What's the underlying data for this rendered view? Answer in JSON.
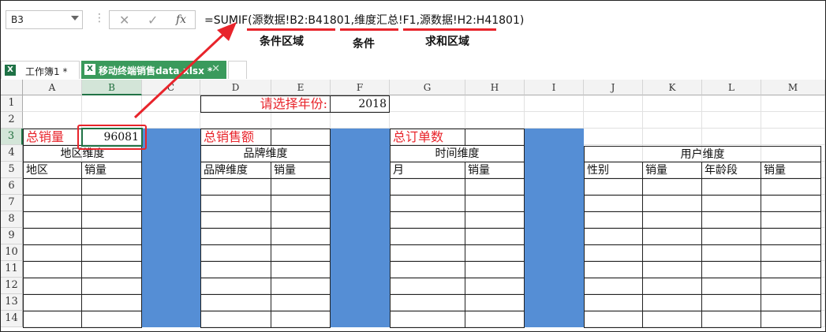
{
  "formula_bar": {
    "name_box": "B3",
    "cancel_icon": "✕",
    "enter_icon": "✓",
    "fx_label": "fx",
    "formula": "=SUMIF(源数据!B2:B41801,维度汇总!F1,源数据!H2:H41801)",
    "annotations": [
      "条件区域",
      "条件",
      "求和区域"
    ]
  },
  "tabs": [
    {
      "label": "工作簿1 *"
    },
    {
      "label": "移动终端销售data.xlsx *"
    }
  ],
  "columns": [
    "A",
    "B",
    "C",
    "D",
    "E",
    "F",
    "G",
    "H",
    "I",
    "J",
    "K",
    "L",
    "M"
  ],
  "rows": [
    "1",
    "2",
    "3",
    "4",
    "5",
    "6",
    "7",
    "8",
    "9",
    "10",
    "11",
    "12",
    "13",
    "14"
  ],
  "cells": {
    "D1": "请选择年份:",
    "F1": "2018",
    "A3": "总销量",
    "B3": "96081",
    "D3": "总销售额",
    "G3": "总订单数",
    "A4": "地区维度",
    "D4": "品牌维度",
    "G4": "时间维度",
    "J4": "用户维度",
    "A5": "地区",
    "B5": "销量",
    "D5": "品牌维度",
    "E5": "销量",
    "G5": "月",
    "H5": "销量",
    "J5": "性别",
    "K5": "销量",
    "L5": "年龄段",
    "M5": "销量"
  },
  "colors": {
    "accent_green": "#217346",
    "highlight_red": "#e8242b",
    "fill_blue": "#558ed5"
  }
}
